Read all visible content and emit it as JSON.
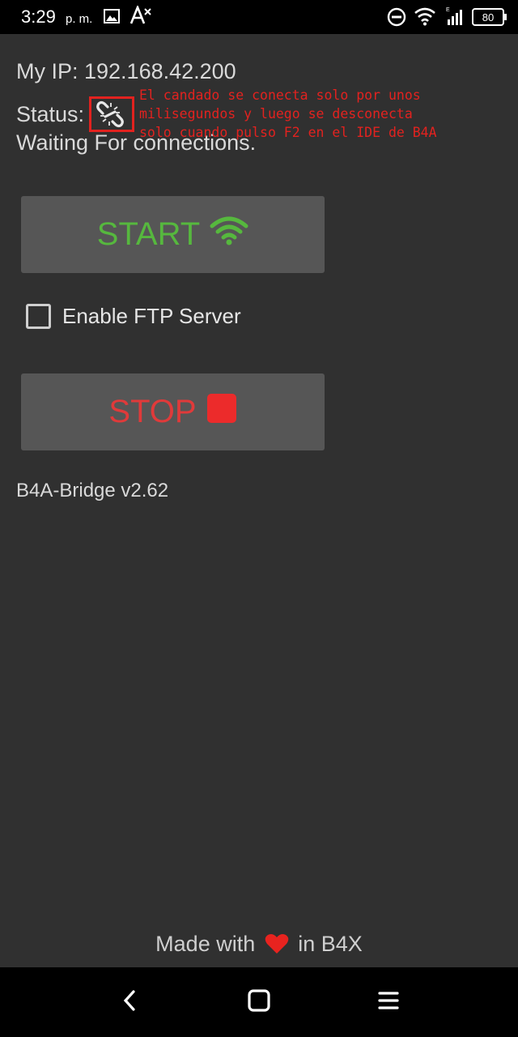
{
  "statusbar": {
    "time": "3:29",
    "ampm": "p. m.",
    "battery": "80",
    "icons": [
      "image-icon",
      "text-format-icon",
      "do-not-disturb-icon",
      "wifi-icon",
      "signal-icon",
      "battery-icon"
    ]
  },
  "main": {
    "ip_text": "My IP: 192.168.42.200",
    "status_label": "Status:",
    "status_icon": "broken-link-icon",
    "waiting_text": "Waiting For connections.",
    "annotation": "El candado se conecta solo por unos\nmilisegundos y luego se desconecta\nsolo cuando pulso F2 en el IDE de B4A",
    "start_label": "START",
    "start_icon": "wifi-icon",
    "ftp_label": "Enable FTP Server",
    "ftp_checked": false,
    "stop_label": "STOP",
    "stop_icon": "stop-square-icon",
    "version": "B4A-Bridge v2.62"
  },
  "footer": {
    "made_with": "Made with",
    "in_b4x": "in B4X"
  },
  "navbar": {
    "icons": [
      "back-icon",
      "home-icon",
      "menu-icon"
    ]
  },
  "colors": {
    "background": "#303030",
    "button": "#565656",
    "start_green": "#56b83e",
    "stop_red": "#e03a3a",
    "annotation_red": "#e2221f",
    "heart_red": "#e8231f"
  }
}
